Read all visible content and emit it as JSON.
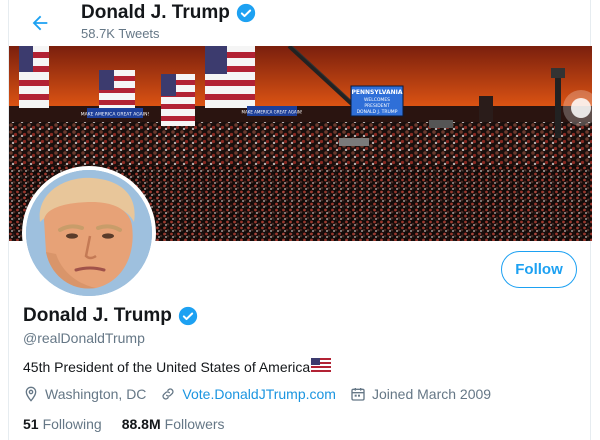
{
  "header": {
    "name": "Donald J. Trump",
    "tweet_count": "58.7K Tweets",
    "back_icon": "back-arrow-icon"
  },
  "banner": {
    "signs": [
      "PENNSYLVANIA",
      "WELCOMES",
      "PRESIDENT",
      "DONALD J. TRUMP"
    ],
    "banner_sign_1": "MAKE AMERICA GREAT AGAIN!",
    "banner_sign_2": "MAKE AMERICA GREAT AGAIN!"
  },
  "profile": {
    "name": "Donald J. Trump",
    "handle": "@realDonaldTrump",
    "bio": "45th President of the United States of America",
    "location": "Washington, DC",
    "website": "Vote.DonaldJTrump.com",
    "joined": "Joined March 2009",
    "follow_label": "Follow",
    "verified_icon": "verified-badge-icon"
  },
  "stats": {
    "following_count": "51",
    "following_label": "Following",
    "followers_count": "88.8M",
    "followers_label": "Followers"
  },
  "colors": {
    "accent": "#1da1f2",
    "link": "#1b95e0",
    "muted": "#657786",
    "text": "#14171a"
  }
}
